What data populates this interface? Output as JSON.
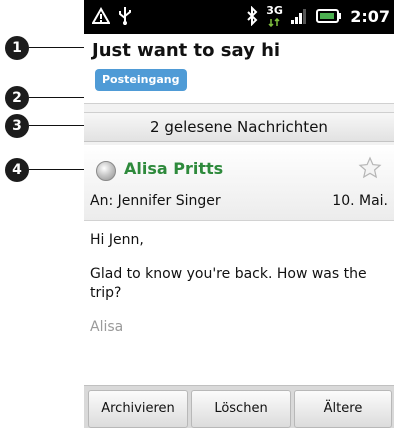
{
  "callouts": [
    "1",
    "2",
    "3",
    "4"
  ],
  "status_bar": {
    "time": "2:07",
    "network": "3G",
    "icons": [
      "warning-icon",
      "usb-icon",
      "bluetooth-icon",
      "3g-icon",
      "signal-icon",
      "battery-icon"
    ]
  },
  "email": {
    "subject": "Just want to say hi",
    "label": "Posteingang",
    "read_messages": "2 gelesene Nachrichten",
    "sender": "Alisa Pritts",
    "recipient": "An: Jennifer Singer",
    "date": "10. Mai.",
    "body": {
      "greeting": "Hi Jenn,",
      "text": "Glad to know you're back. How was the trip?",
      "signature": "Alisa"
    }
  },
  "actions": {
    "archive": "Archivieren",
    "delete": "Löschen",
    "older": "Ältere"
  },
  "colors": {
    "sender": "#2e8a3c",
    "label_chip": "#4f9bd6",
    "status_bar": "#000000"
  }
}
